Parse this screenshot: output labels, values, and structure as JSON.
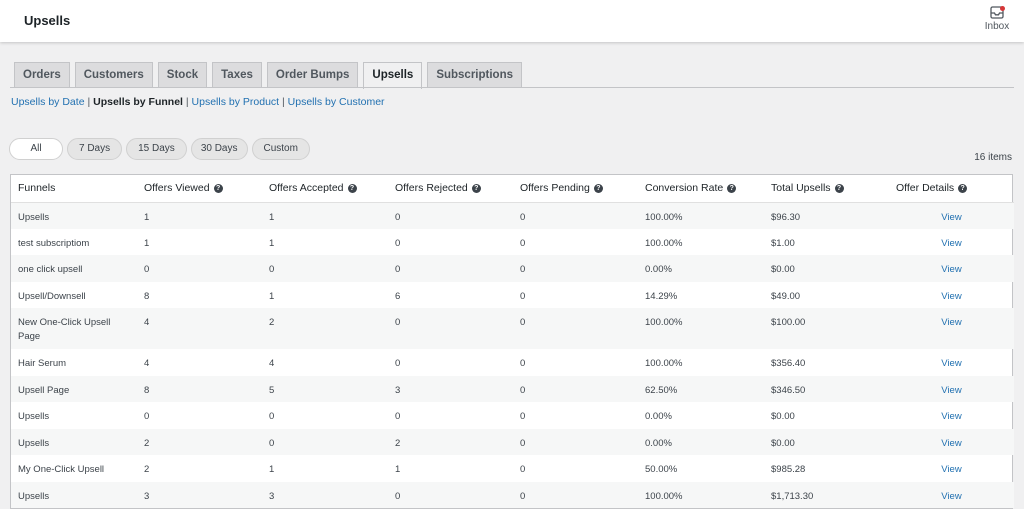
{
  "header": {
    "title": "Upsells",
    "inbox_label": "Inbox",
    "inbox_icon": "inbox-icon"
  },
  "tabs": [
    {
      "label": "Orders",
      "active": false
    },
    {
      "label": "Customers",
      "active": false
    },
    {
      "label": "Stock",
      "active": false
    },
    {
      "label": "Taxes",
      "active": false
    },
    {
      "label": "Order Bumps",
      "active": false
    },
    {
      "label": "Upsells",
      "active": true
    },
    {
      "label": "Subscriptions",
      "active": false
    }
  ],
  "subnav": {
    "by_date": "Upsells by Date",
    "separator": " | ",
    "by_funnel": "Upsells by Funnel",
    "by_product": "Upsells by Product",
    "by_customer": "Upsells by Customer"
  },
  "filters": [
    "All",
    "7 Days",
    "15 Days",
    "30 Days",
    "Custom"
  ],
  "items_count": "16 items",
  "table": {
    "columns": [
      "Funnels",
      "Offers Viewed",
      "Offers Accepted",
      "Offers Rejected",
      "Offers Pending",
      "Conversion Rate",
      "Total Upsells",
      "Offer Details"
    ],
    "rows": [
      [
        "Upsells",
        "1",
        "1",
        "0",
        "0",
        "100.00%",
        "$96.30",
        "View"
      ],
      [
        "test subscriptiom",
        "1",
        "1",
        "0",
        "0",
        "100.00%",
        "$1.00",
        "View"
      ],
      [
        "one click upsell",
        "0",
        "0",
        "0",
        "0",
        "0.00%",
        "$0.00",
        "View"
      ],
      [
        "Upsell/Downsell",
        "8",
        "1",
        "6",
        "0",
        "14.29%",
        "$49.00",
        "View"
      ],
      [
        "New One-Click Upsell Page",
        "4",
        "2",
        "0",
        "0",
        "100.00%",
        "$100.00",
        "View"
      ],
      [
        "Hair Serum",
        "4",
        "4",
        "0",
        "0",
        "100.00%",
        "$356.40",
        "View"
      ],
      [
        "Upsell Page",
        "8",
        "5",
        "3",
        "0",
        "62.50%",
        "$346.50",
        "View"
      ],
      [
        "Upsells",
        "0",
        "0",
        "0",
        "0",
        "0.00%",
        "$0.00",
        "View"
      ],
      [
        "Upsells",
        "2",
        "0",
        "2",
        "0",
        "0.00%",
        "$0.00",
        "View"
      ],
      [
        "My One-Click Upsell",
        "2",
        "1",
        "1",
        "0",
        "50.00%",
        "$985.28",
        "View"
      ],
      [
        "Upsells",
        "3",
        "3",
        "0",
        "0",
        "100.00%",
        "$1,713.30",
        "View"
      ]
    ]
  },
  "colors": {
    "link": "#2271b1",
    "notification": "#d63638",
    "header_bg": "#ffffff",
    "page_bg": "#f0f0f1"
  }
}
